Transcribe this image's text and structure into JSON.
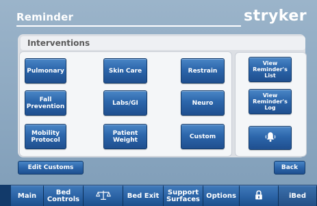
{
  "header": {
    "title": "Reminder",
    "brand": "stryker"
  },
  "section": {
    "title": "Interventions"
  },
  "interventions": {
    "buttons": [
      {
        "label": "Pulmonary"
      },
      {
        "label": "Skin Care"
      },
      {
        "label": "Restrain"
      },
      {
        "label": "Fall\nPrevention"
      },
      {
        "label": "Labs/GI"
      },
      {
        "label": "Neuro"
      },
      {
        "label": "Mobility\nProtocol"
      },
      {
        "label": "Patient\nWeight"
      },
      {
        "label": "Custom"
      }
    ]
  },
  "side": {
    "view_list": "View\nReminder's\nList",
    "view_log": "View\nReminder's\nLog",
    "alarm_icon": "bell-icon"
  },
  "actions": {
    "edit_customs": "Edit Customs",
    "back": "Back"
  },
  "tabs": [
    {
      "label": "Main"
    },
    {
      "label": "Bed\nControls"
    },
    {
      "icon": "scale-icon"
    },
    {
      "label": "Bed Exit"
    },
    {
      "label": "Support\nSurfaces"
    },
    {
      "label": "Options"
    },
    {
      "icon": "lock-icon"
    },
    {
      "label": "iBed"
    }
  ],
  "colors": {
    "accent": "#2c66ab",
    "background": "#8aa6bf",
    "panel": "#dcdfe4"
  }
}
